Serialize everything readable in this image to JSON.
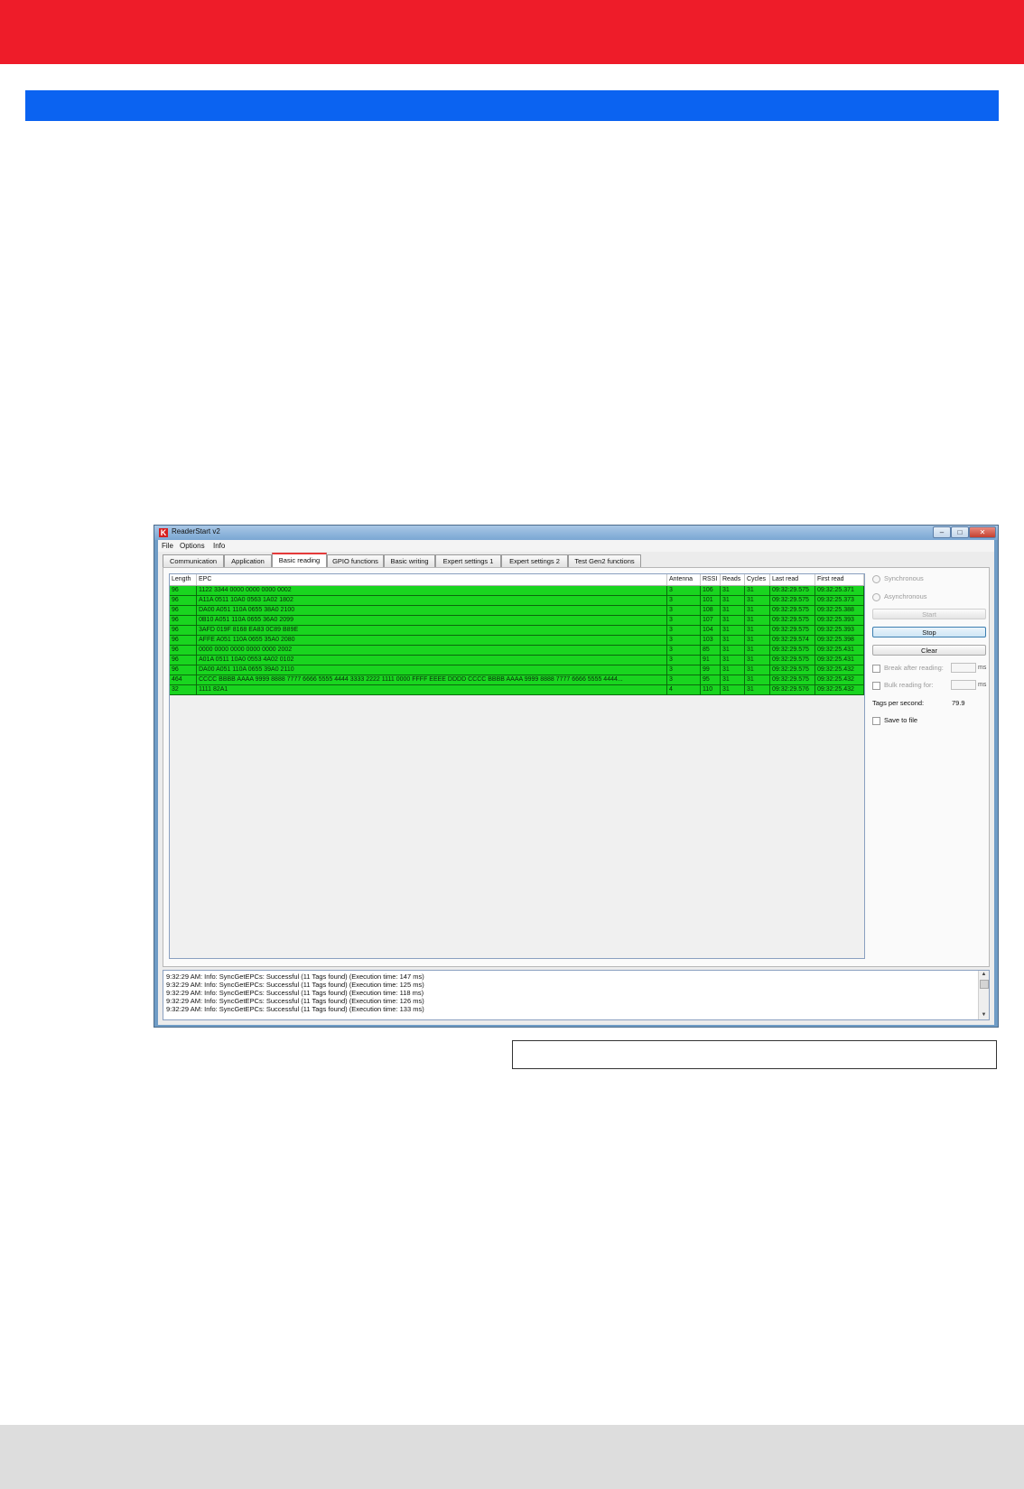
{
  "window": {
    "title": "ReaderStart v2",
    "logo_letter": "K",
    "controls": {
      "minimize": "–",
      "maximize": "□",
      "close": "✕"
    }
  },
  "menu": [
    "File",
    "Options",
    "Info"
  ],
  "tabs": [
    {
      "label": "Communication"
    },
    {
      "label": "Application"
    },
    {
      "label": "Basic reading",
      "active": true
    },
    {
      "label": "GPIO functions"
    },
    {
      "label": "Basic writing"
    },
    {
      "label": "Expert settings 1"
    },
    {
      "label": "Expert settings 2"
    },
    {
      "label": "Test Gen2 functions"
    }
  ],
  "table": {
    "columns": [
      "Length",
      "EPC",
      "Antenna",
      "RSSI",
      "Reads",
      "Cycles",
      "Last read",
      "First read"
    ],
    "rows": [
      [
        "96",
        "1122 3344 0000 0000 0000 0002",
        "3",
        "106",
        "31",
        "31",
        "09:32:29.575",
        "09:32:25.371"
      ],
      [
        "96",
        "A11A 0511 10A0 0563 1A02 1802",
        "3",
        "101",
        "31",
        "31",
        "09:32:29.575",
        "09:32:25.373"
      ],
      [
        "96",
        "DA00 A051 110A 0655 38A0 2100",
        "3",
        "108",
        "31",
        "31",
        "09:32:29.575",
        "09:32:25.388"
      ],
      [
        "96",
        "0B10 A051 110A 0655 36A0 2099",
        "3",
        "107",
        "31",
        "31",
        "09:32:29.575",
        "09:32:25.393"
      ],
      [
        "96",
        "3AFD 019F 8168 EA83 0C89 B89E",
        "3",
        "104",
        "31",
        "31",
        "09:32:29.575",
        "09:32:25.393"
      ],
      [
        "96",
        "AFFE A051 110A 0655 35A0 2080",
        "3",
        "103",
        "31",
        "31",
        "09:32:29.574",
        "09:32:25.398"
      ],
      [
        "96",
        "0000 0000 0000 0000 0000 2002",
        "3",
        "85",
        "31",
        "31",
        "09:32:29.575",
        "09:32:25.431"
      ],
      [
        "96",
        "A01A 0511 10A0 0553 4A02 0102",
        "3",
        "91",
        "31",
        "31",
        "09:32:29.575",
        "09:32:25.431"
      ],
      [
        "96",
        "DA00 A051 110A 0655 39A0 2110",
        "3",
        "99",
        "31",
        "31",
        "09:32:29.575",
        "09:32:25.432"
      ],
      [
        "464",
        "CCCC BBBB AAAA 9999 8888 7777 6666 5555 4444 3333 2222 1111 0000 FFFF EEEE DDDD CCCC BBBB AAAA 9999 8888 7777 6666 5555 4444...",
        "3",
        "95",
        "31",
        "31",
        "09:32:29.575",
        "09:32:25.432"
      ],
      [
        "32",
        "1111 82A1",
        "4",
        "110",
        "31",
        "31",
        "09:32:29.576",
        "09:32:25.432"
      ]
    ]
  },
  "side_panel": {
    "synchronous": "Synchronous",
    "asynchronous": "Asynchronous",
    "start": "Start",
    "stop": "Stop",
    "clear": "Clear",
    "break_after_reading": "Break after reading:",
    "bulk_reading_for": "Bulk reading for:",
    "unit_ms": "ms",
    "tags_per_second_label": "Tags per second:",
    "tags_per_second_value": "79.9",
    "save_to_file": "Save to file"
  },
  "log": [
    "9:32:29 AM: Info: SyncGetEPCs: Successful (11 Tags found) (Execution time: 147 ms)",
    "9:32:29 AM: Info: SyncGetEPCs: Successful (11 Tags found) (Execution time: 125 ms)",
    "9:32:29 AM: Info: SyncGetEPCs: Successful (11 Tags found) (Execution time: 118 ms)",
    "9:32:29 AM: Info: SyncGetEPCs: Successful (11 Tags found) (Execution time: 126 ms)",
    "9:32:29 AM: Info: SyncGetEPCs: Successful (11 Tags found) (Execution time: 133 ms)"
  ],
  "colors": {
    "header_red": "#ee1c29",
    "header_blue": "#0b63f1",
    "row_green": "#19d51f",
    "footer_gray": "#dddddd"
  }
}
